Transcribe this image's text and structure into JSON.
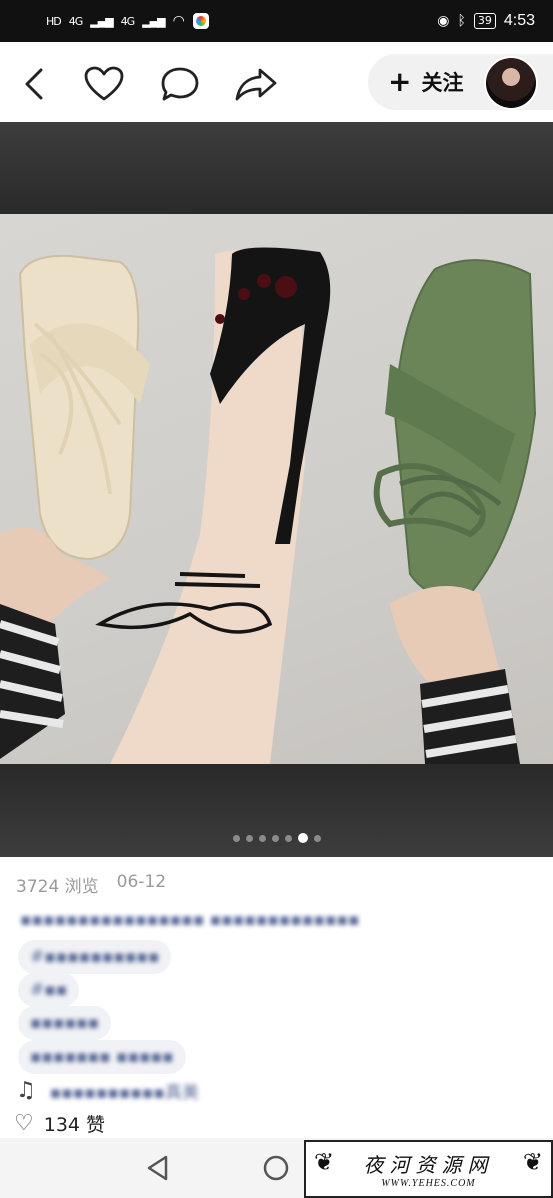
{
  "status_bar": {
    "left": [
      "HD",
      "4G",
      "4G"
    ],
    "battery": "39",
    "time": "4:53"
  },
  "header": {
    "follow_plus": "+",
    "follow_label": "关注"
  },
  "carousel": {
    "total": 7,
    "active_index": 5
  },
  "post": {
    "views": "3724 浏览",
    "date": "06-12",
    "title": "▪▪▪▪▪▪▪▪▪▪▪▪▪▪▪▪ ▪▪▪▪▪▪▪▪▪▪▪▪▪",
    "tags": [
      "#▪▪▪▪▪▪▪▪▪▪",
      "#▪▪",
      "▪▪▪▪▪▪",
      "▪▪▪▪▪▪▪ ▪▪▪▪▪"
    ],
    "music": "▪▪▪▪▪▪▪▪▪▪真美",
    "likes": "134 赞"
  },
  "watermark": {
    "cn": "夜河资源网",
    "en": "WWW.YEHES.COM"
  },
  "colors": {
    "status_bg": "#111111",
    "tag_bg": "#f1f2f5",
    "tag_text": "#4a63a5"
  }
}
